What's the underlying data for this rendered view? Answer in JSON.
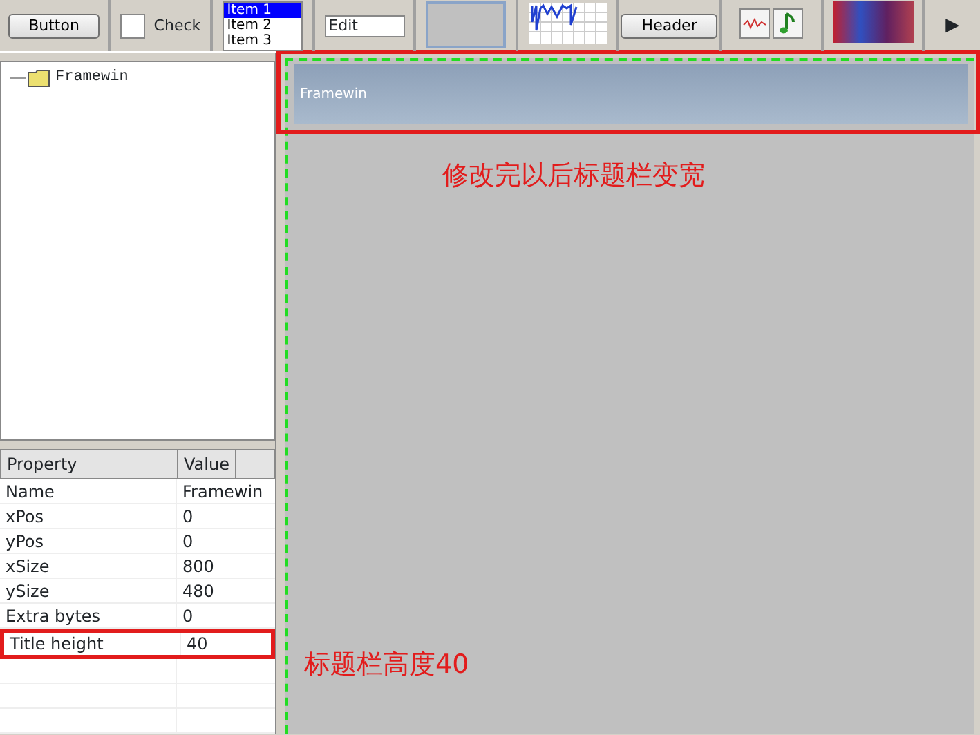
{
  "toolbar": {
    "button_label": "Button",
    "checkbox": {
      "label": "Check",
      "checked": false
    },
    "listbox": [
      {
        "label": "Item 1",
        "selected": true
      },
      {
        "label": "Item 2",
        "selected": false
      },
      {
        "label": "Item 3",
        "selected": false
      }
    ],
    "edit_value": "Edit",
    "header_label": "Header",
    "more": "▶"
  },
  "tree": [
    {
      "label": "Framewin"
    }
  ],
  "properties": {
    "columns": [
      "Property",
      "Value"
    ],
    "rows": [
      {
        "property": "Name",
        "value": "Framewin",
        "highlighted": false
      },
      {
        "property": "xPos",
        "value": "0",
        "highlighted": false
      },
      {
        "property": "yPos",
        "value": "0",
        "highlighted": false
      },
      {
        "property": "xSize",
        "value": "800",
        "highlighted": false
      },
      {
        "property": "ySize",
        "value": "480",
        "highlighted": false
      },
      {
        "property": "Extra bytes",
        "value": "0",
        "highlighted": false
      },
      {
        "property": "Title height",
        "value": "40",
        "highlighted": true
      }
    ]
  },
  "canvas": {
    "frame_title": "Framewin",
    "title_highlighted": true
  },
  "annotations": [
    {
      "text": "修改完以后标题栏变宽"
    },
    {
      "text": "标题栏高度40"
    }
  ]
}
